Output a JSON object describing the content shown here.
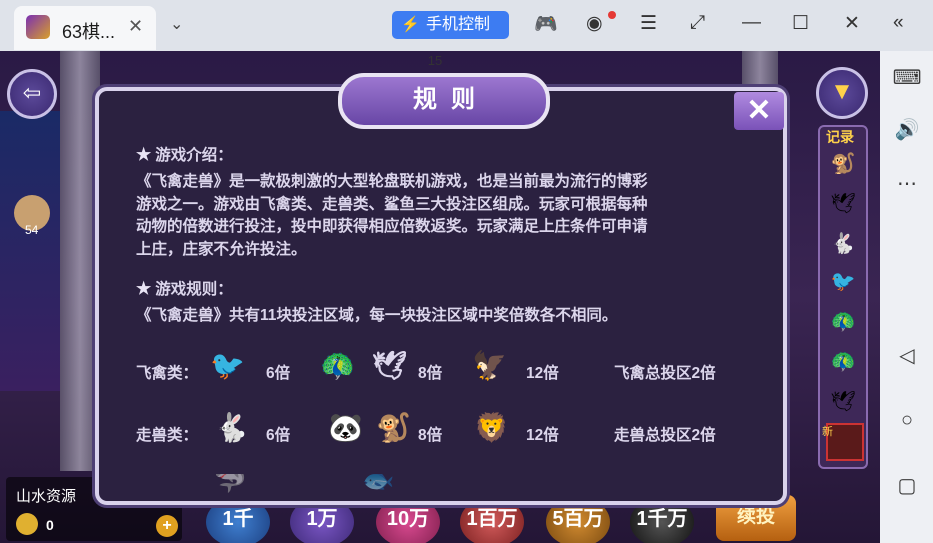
{
  "titlebar": {
    "tab_title": "63棋...",
    "tab_close": "✕",
    "dropdown": "⌄",
    "phone_control": "手机控制"
  },
  "game": {
    "round_number": "15",
    "online_count": "54",
    "player_name": "山水资源",
    "coins": "0",
    "record_label": "记录",
    "new_tag": "新",
    "chips": [
      "1千",
      "1万",
      "10万",
      "1百万",
      "5百万",
      "1千万"
    ],
    "rebet_label": "续投"
  },
  "modal": {
    "title": "规则",
    "intro_heading": "游戏介绍：",
    "intro_lines": [
      "《飞禽走兽》是一款极刺激的大型轮盘联机游戏，也是当前最为流行的博彩",
      "游戏之一。游戏由飞禽类、走兽类、鲨鱼三大投注区组成。玩家可根据每种",
      "动物的倍数进行投注，投中即获得相应倍数返奖。玩家满足上庄条件可申请",
      "上庄，庄家不允许投注。"
    ],
    "rules_heading": "游戏规则：",
    "rules_text": "《飞禽走兽》共有11块投注区域，每一块投注区域中奖倍数各不相同。",
    "birds": {
      "label": "飞禽类：",
      "mult1": "6倍",
      "mult2": "8倍",
      "mult3": "12倍",
      "total": "飞禽总投区2倍"
    },
    "beasts": {
      "label": "走兽类：",
      "mult1": "6倍",
      "mult2": "8倍",
      "mult3": "12倍",
      "total": "走兽总投区2倍"
    }
  },
  "colors": {
    "accent": "#3d7cf2",
    "modal_bg": "#2b2140",
    "gold": "#ffd24a"
  }
}
